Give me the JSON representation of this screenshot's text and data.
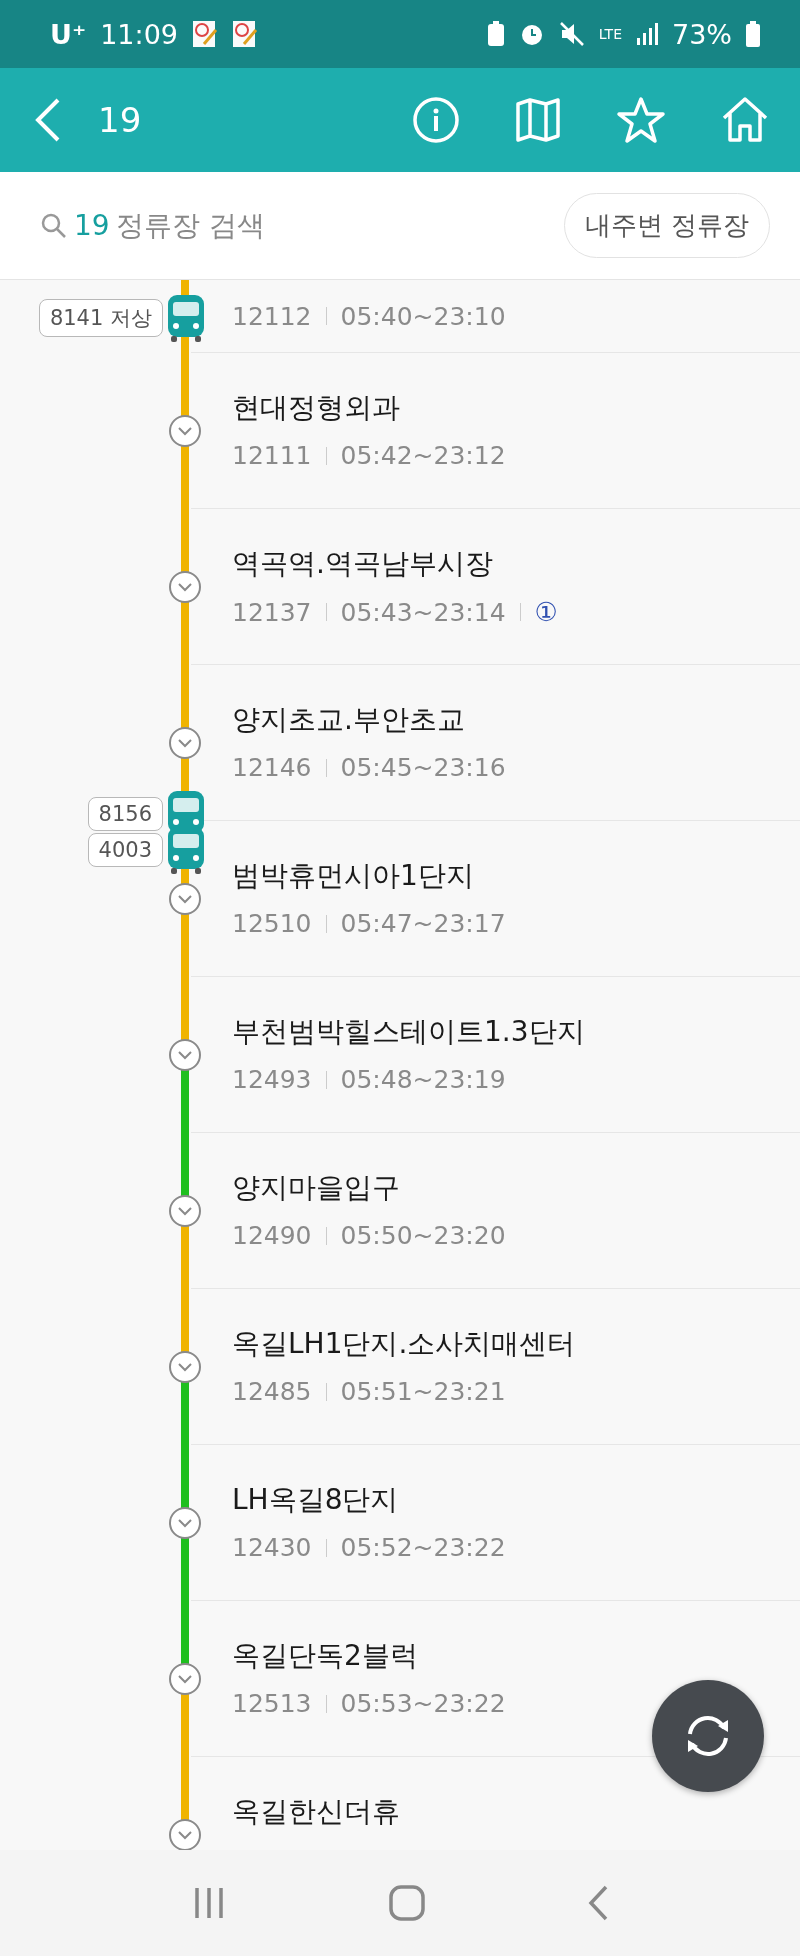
{
  "status_bar": {
    "carrier": "U⁺",
    "time": "11:09",
    "network": "LTE",
    "battery": "73%"
  },
  "header": {
    "title": "19"
  },
  "search": {
    "route": "19",
    "placeholder": "정류장 검색",
    "nearby_button": "내주변 정류장"
  },
  "stops": [
    {
      "kind": "partial",
      "code": "12112",
      "hours": "05:40~23:10",
      "color": "#f0b400",
      "buses": [
        "8141 저상"
      ]
    },
    {
      "kind": "full",
      "name": "현대정형외과",
      "code": "12111",
      "hours": "05:42~23:12",
      "color": "#f0b400"
    },
    {
      "kind": "full",
      "name": "역곡역.역곡남부시장",
      "code": "12137",
      "hours": "05:43~23:14",
      "transfer": "①",
      "color": "#f0b400"
    },
    {
      "kind": "full",
      "name": "양지초교.부안초교",
      "code": "12146",
      "hours": "05:45~23:16",
      "color": "#f0b400",
      "buses": [
        "8156",
        "4003"
      ]
    },
    {
      "kind": "full",
      "name": "범박휴먼시아1단지",
      "code": "12510",
      "hours": "05:47~23:17",
      "color": "#f0b400"
    },
    {
      "kind": "full",
      "name": "부천범박힐스테이트1.3단지",
      "code": "12493",
      "hours": "05:48~23:19",
      "color": "#1fbf1f"
    },
    {
      "kind": "full",
      "name": "양지마을입구",
      "code": "12490",
      "hours": "05:50~23:20",
      "color": "#f0b400"
    },
    {
      "kind": "full",
      "name": "옥길LH1단지.소사치매센터",
      "code": "12485",
      "hours": "05:51~23:21",
      "color": "#1fbf1f"
    },
    {
      "kind": "full",
      "name": "LH옥길8단지",
      "code": "12430",
      "hours": "05:52~23:22",
      "color": "#1fbf1f"
    },
    {
      "kind": "full",
      "name": "옥길단독2블럭",
      "code": "12513",
      "hours": "05:53~23:22",
      "color": "#f0b400"
    },
    {
      "kind": "full",
      "name": "옥길한신더휴"
    }
  ]
}
